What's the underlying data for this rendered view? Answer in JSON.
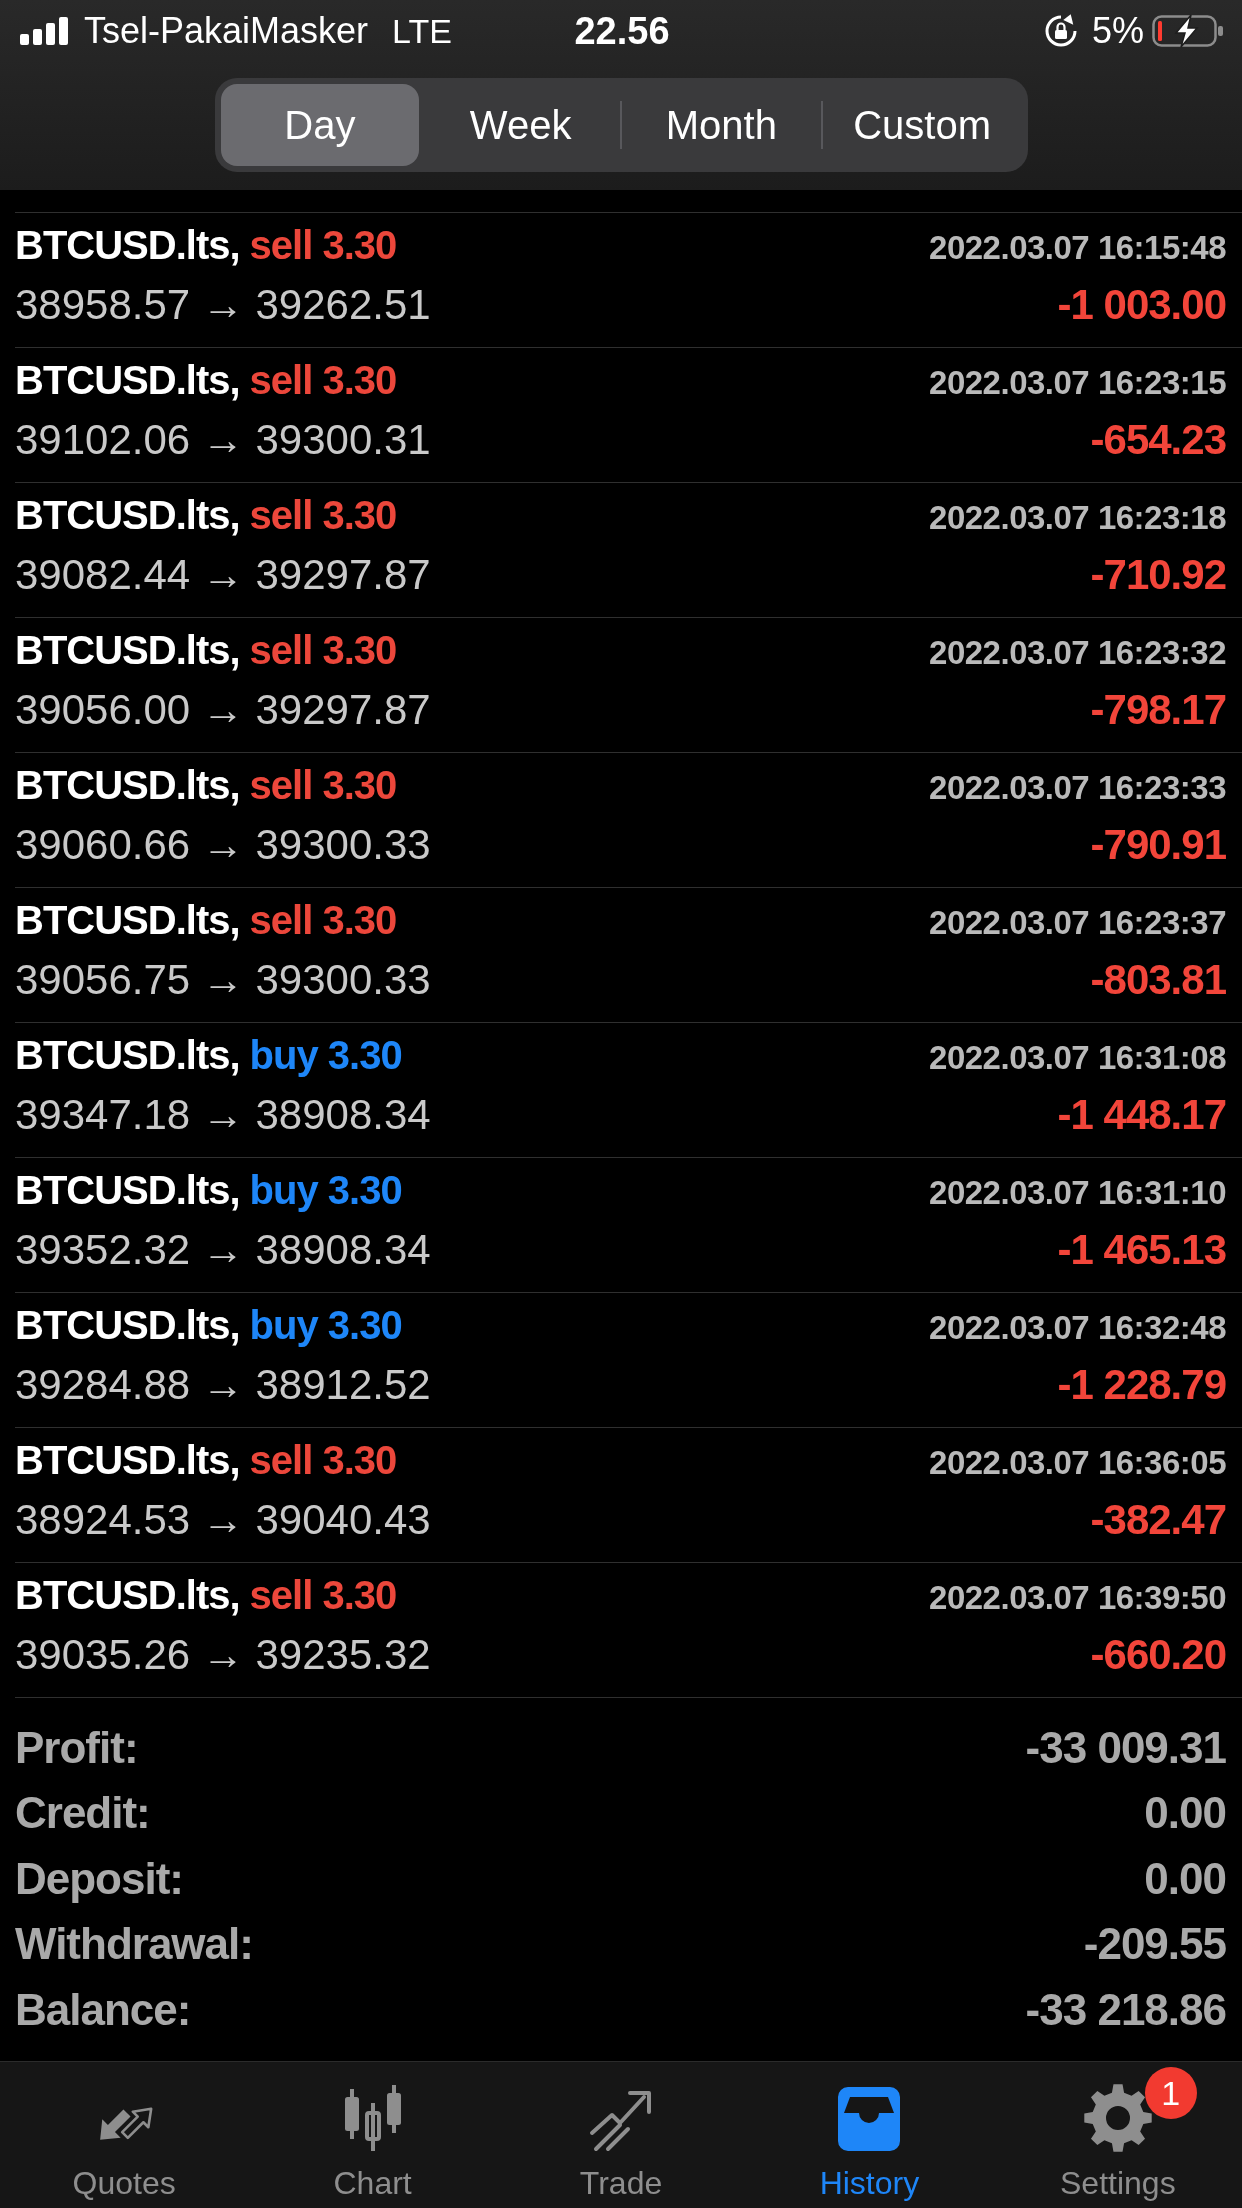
{
  "status_bar": {
    "carrier": "Tsel-PakaiMasker",
    "network": "LTE",
    "time": "22.56",
    "battery_percent": "5%"
  },
  "period_tabs": [
    {
      "label": "Day",
      "selected": true
    },
    {
      "label": "Week",
      "selected": false
    },
    {
      "label": "Month",
      "selected": false
    },
    {
      "label": "Custom",
      "selected": false
    }
  ],
  "deals": [
    {
      "symbol": "BTCUSD.lts,",
      "kind": "sell",
      "trade": "sell 3.30",
      "time": "2022.03.07 16:15:48",
      "prices": "38958.57 → 39262.51",
      "profit": "-1 003.00"
    },
    {
      "symbol": "BTCUSD.lts,",
      "kind": "sell",
      "trade": "sell 3.30",
      "time": "2022.03.07 16:23:15",
      "prices": "39102.06 → 39300.31",
      "profit": "-654.23"
    },
    {
      "symbol": "BTCUSD.lts,",
      "kind": "sell",
      "trade": "sell 3.30",
      "time": "2022.03.07 16:23:18",
      "prices": "39082.44 → 39297.87",
      "profit": "-710.92"
    },
    {
      "symbol": "BTCUSD.lts,",
      "kind": "sell",
      "trade": "sell 3.30",
      "time": "2022.03.07 16:23:32",
      "prices": "39056.00 → 39297.87",
      "profit": "-798.17"
    },
    {
      "symbol": "BTCUSD.lts,",
      "kind": "sell",
      "trade": "sell 3.30",
      "time": "2022.03.07 16:23:33",
      "prices": "39060.66 → 39300.33",
      "profit": "-790.91"
    },
    {
      "symbol": "BTCUSD.lts,",
      "kind": "sell",
      "trade": "sell 3.30",
      "time": "2022.03.07 16:23:37",
      "prices": "39056.75 → 39300.33",
      "profit": "-803.81"
    },
    {
      "symbol": "BTCUSD.lts,",
      "kind": "buy",
      "trade": "buy 3.30",
      "time": "2022.03.07 16:31:08",
      "prices": "39347.18 → 38908.34",
      "profit": "-1 448.17"
    },
    {
      "symbol": "BTCUSD.lts,",
      "kind": "buy",
      "trade": "buy 3.30",
      "time": "2022.03.07 16:31:10",
      "prices": "39352.32 → 38908.34",
      "profit": "-1 465.13"
    },
    {
      "symbol": "BTCUSD.lts,",
      "kind": "buy",
      "trade": "buy 3.30",
      "time": "2022.03.07 16:32:48",
      "prices": "39284.88 → 38912.52",
      "profit": "-1 228.79"
    },
    {
      "symbol": "BTCUSD.lts,",
      "kind": "sell",
      "trade": "sell 3.30",
      "time": "2022.03.07 16:36:05",
      "prices": "38924.53 → 39040.43",
      "profit": "-382.47"
    },
    {
      "symbol": "BTCUSD.lts,",
      "kind": "sell",
      "trade": "sell 3.30",
      "time": "2022.03.07 16:39:50",
      "prices": "39035.26 → 39235.32",
      "profit": "-660.20"
    }
  ],
  "summary": [
    {
      "label": "Profit:",
      "value": "-33 009.31"
    },
    {
      "label": "Credit:",
      "value": "0.00"
    },
    {
      "label": "Deposit:",
      "value": "0.00"
    },
    {
      "label": "Withdrawal:",
      "value": "-209.55"
    },
    {
      "label": "Balance:",
      "value": "-33 218.86"
    }
  ],
  "tab_bar": [
    {
      "label": "Quotes",
      "selected": false
    },
    {
      "label": "Chart",
      "selected": false
    },
    {
      "label": "Trade",
      "selected": false
    },
    {
      "label": "History",
      "selected": true
    },
    {
      "label": "Settings",
      "selected": false,
      "badge": "1"
    }
  ]
}
